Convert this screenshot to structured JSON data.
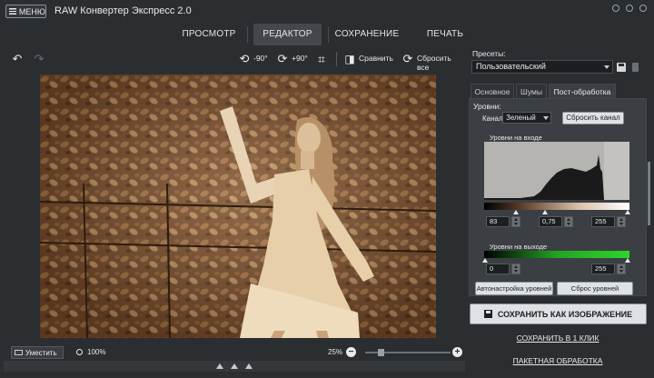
{
  "titlebar": {
    "menu_label": "МЕНЮ",
    "app_title": "RAW Конвертер Экспресс 2.0"
  },
  "main_tabs": [
    {
      "label": "ПРОСМОТР",
      "active": false
    },
    {
      "label": "РЕДАКТОР",
      "active": true
    },
    {
      "label": "СОХРАНЕНИЕ",
      "active": false
    },
    {
      "label": "ПЕЧАТЬ",
      "active": false
    }
  ],
  "toolbar": {
    "rotate_left_label": "-90°",
    "rotate_right_label": "+90°",
    "compare_label": "Сравнить",
    "reset_all_label": "Сбросить все"
  },
  "statusbar": {
    "fit_label": "Уместить",
    "zoom_100_label": "100%",
    "zoom_percent": "25%"
  },
  "panel": {
    "presets_label": "Пресеты:",
    "preset_value": "Пользовательский",
    "sub_tabs": [
      {
        "label": "Основное",
        "active": false
      },
      {
        "label": "Шумы",
        "active": false
      },
      {
        "label": "Пост-обработка",
        "active": true
      }
    ],
    "levels": {
      "title": "Уровни:",
      "channel_label": "Канал",
      "channel_value": "Зеленый",
      "reset_channel_label": "Сбросить канал",
      "input_label": "Уровни на входе",
      "input_black": "83",
      "input_gamma": "0,75",
      "input_white": "255",
      "output_label": "Уровни на выходе",
      "output_black": "0",
      "output_white": "255",
      "auto_label": "Автонастройка уровней",
      "reset_levels_label": "Сброс уровней"
    },
    "save_image_label": "СОХРАНИТЬ КАК ИЗОБРАЖЕНИЕ",
    "save_one_click_label": "СОХРАНИТЬ В 1 КЛИК",
    "batch_label": "ПАКЕТНАЯ ОБРАБОТКА"
  },
  "colors": {
    "background": "#2b2e31",
    "panel": "#3b3f43",
    "output_gradient": "#2ad62a",
    "sepia": "#8a5a35"
  }
}
